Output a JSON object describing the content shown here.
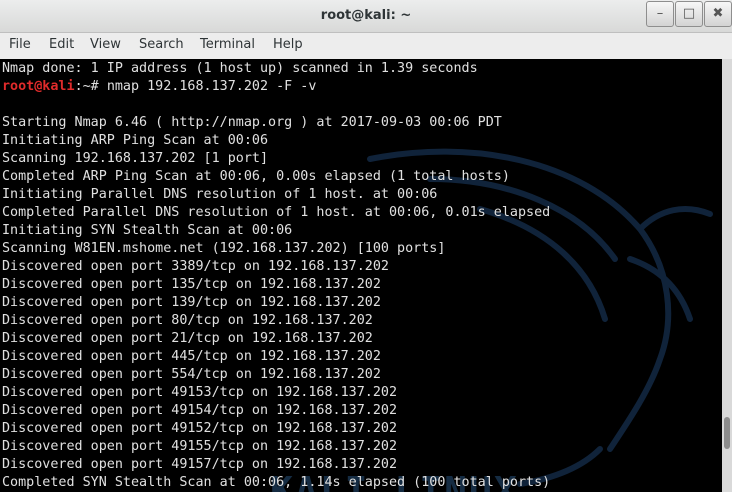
{
  "window": {
    "title": "root@kali: ~",
    "minimize_glyph": "–",
    "maximize_glyph": "□",
    "close_glyph": "✖"
  },
  "menu": [
    "File",
    "Edit",
    "View",
    "Search",
    "Terminal",
    "Help"
  ],
  "watermark": "KALI LINUX",
  "terminal": {
    "first_line": "Nmap done: 1 IP address (1 host up) scanned in 1.39 seconds",
    "prompt_user": "root@kali",
    "prompt_suffix": ":~# ",
    "command": "nmap 192.168.137.202 -F -v",
    "output": [
      "",
      "Starting Nmap 6.46 ( http://nmap.org ) at 2017-09-03 00:06 PDT",
      "Initiating ARP Ping Scan at 00:06",
      "Scanning 192.168.137.202 [1 port]",
      "Completed ARP Ping Scan at 00:06, 0.00s elapsed (1 total hosts)",
      "Initiating Parallel DNS resolution of 1 host. at 00:06",
      "Completed Parallel DNS resolution of 1 host. at 00:06, 0.01s elapsed",
      "Initiating SYN Stealth Scan at 00:06",
      "Scanning W81EN.mshome.net (192.168.137.202) [100 ports]",
      "Discovered open port 3389/tcp on 192.168.137.202",
      "Discovered open port 135/tcp on 192.168.137.202",
      "Discovered open port 139/tcp on 192.168.137.202",
      "Discovered open port 80/tcp on 192.168.137.202",
      "Discovered open port 21/tcp on 192.168.137.202",
      "Discovered open port 445/tcp on 192.168.137.202",
      "Discovered open port 554/tcp on 192.168.137.202",
      "Discovered open port 49153/tcp on 192.168.137.202",
      "Discovered open port 49154/tcp on 192.168.137.202",
      "Discovered open port 49152/tcp on 192.168.137.202",
      "Discovered open port 49155/tcp on 192.168.137.202",
      "Discovered open port 49157/tcp on 192.168.137.202",
      "Completed SYN Stealth Scan at 00:06, 1.14s elapsed (100 total ports)"
    ]
  }
}
